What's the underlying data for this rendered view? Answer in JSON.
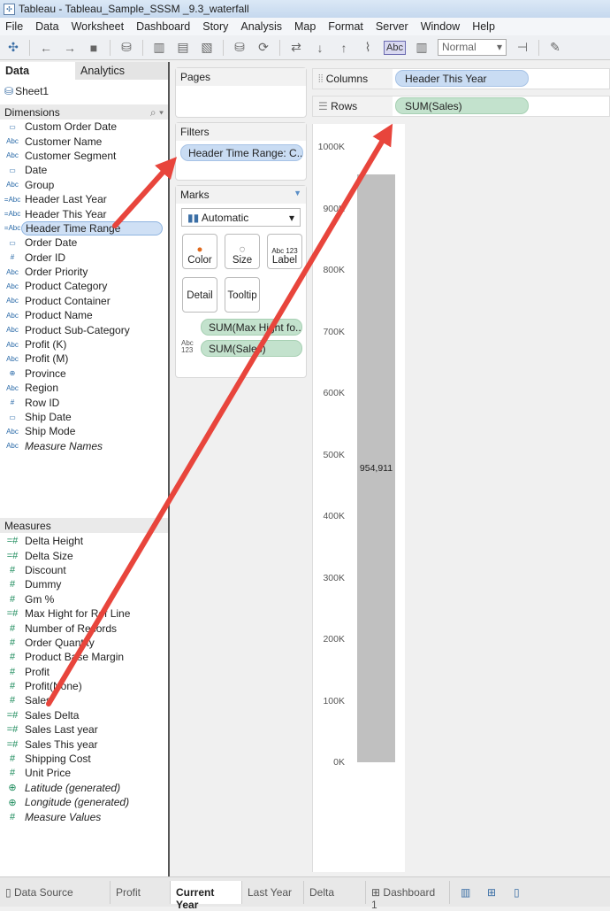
{
  "window": {
    "title": "Tableau - Tableau_Sample_SSSM _9.3_waterfall"
  },
  "menu": [
    "File",
    "Data",
    "Worksheet",
    "Dashboard",
    "Story",
    "Analysis",
    "Map",
    "Format",
    "Server",
    "Window",
    "Help"
  ],
  "toolbar": {
    "abc_label": "Abc",
    "fit_select": "Normal"
  },
  "left_panel": {
    "tabs": [
      "Data",
      "Analytics"
    ],
    "datasource": "Sheet1",
    "dimensions_label": "Dimensions",
    "dimensions": [
      {
        "name": "Custom Order Date",
        "icon": "calendar"
      },
      {
        "name": "Customer Name",
        "icon": "Abc"
      },
      {
        "name": "Customer Segment",
        "icon": "Abc"
      },
      {
        "name": "Date",
        "icon": "calendar"
      },
      {
        "name": "Group",
        "icon": "Abc"
      },
      {
        "name": "Header Last Year",
        "icon": "=Abc"
      },
      {
        "name": "Header This Year",
        "icon": "=Abc"
      },
      {
        "name": "Header Time Range",
        "icon": "=Abc",
        "selected": true
      },
      {
        "name": "Order Date",
        "icon": "calendar"
      },
      {
        "name": "Order ID",
        "icon": "#"
      },
      {
        "name": "Order Priority",
        "icon": "Abc"
      },
      {
        "name": "Product Category",
        "icon": "Abc"
      },
      {
        "name": "Product Container",
        "icon": "Abc"
      },
      {
        "name": "Product Name",
        "icon": "Abc"
      },
      {
        "name": "Product Sub-Category",
        "icon": "Abc"
      },
      {
        "name": "Profit (K)",
        "icon": "Abc"
      },
      {
        "name": "Profit (M)",
        "icon": "Abc"
      },
      {
        "name": "Province",
        "icon": "globe"
      },
      {
        "name": "Region",
        "icon": "Abc"
      },
      {
        "name": "Row ID",
        "icon": "#"
      },
      {
        "name": "Ship Date",
        "icon": "calendar"
      },
      {
        "name": "Ship Mode",
        "icon": "Abc"
      },
      {
        "name": "Measure Names",
        "icon": "Abc",
        "italic": true
      }
    ],
    "measures_label": "Measures",
    "measures": [
      {
        "name": "Delta Height",
        "icon": "=#"
      },
      {
        "name": "Delta Size",
        "icon": "=#"
      },
      {
        "name": "Discount",
        "icon": "#"
      },
      {
        "name": "Dummy",
        "icon": "#"
      },
      {
        "name": "Gm %",
        "icon": "#"
      },
      {
        "name": "Max Hight for Ref Line",
        "icon": "=#"
      },
      {
        "name": "Number of Records",
        "icon": "#"
      },
      {
        "name": "Order Quantity",
        "icon": "#"
      },
      {
        "name": "Product Base Margin",
        "icon": "#"
      },
      {
        "name": "Profit",
        "icon": "#"
      },
      {
        "name": "Profit(None)",
        "icon": "#"
      },
      {
        "name": "Sales",
        "icon": "#"
      },
      {
        "name": "Sales Delta",
        "icon": "=#"
      },
      {
        "name": "Sales Last year",
        "icon": "=#"
      },
      {
        "name": "Sales This year",
        "icon": "=#"
      },
      {
        "name": "Shipping Cost",
        "icon": "#"
      },
      {
        "name": "Unit Price",
        "icon": "#"
      },
      {
        "name": "Latitude (generated)",
        "icon": "globe",
        "italic": true
      },
      {
        "name": "Longitude (generated)",
        "icon": "globe",
        "italic": true
      },
      {
        "name": "Measure Values",
        "icon": "#",
        "italic": true
      }
    ]
  },
  "pages": {
    "label": "Pages"
  },
  "filters": {
    "label": "Filters",
    "pill": "Header Time Range: C.."
  },
  "marks": {
    "label": "Marks",
    "type": "Automatic",
    "buttons": [
      "Color",
      "Size",
      "Label",
      "Detail",
      "Tooltip"
    ],
    "pills": [
      "SUM(Max Hight fo..",
      "SUM(Sales)"
    ]
  },
  "shelves": {
    "columns_label": "Columns",
    "columns_pill": "Header This Year",
    "rows_label": "Rows",
    "rows_pill": "SUM(Sales)"
  },
  "chart_data": {
    "type": "bar",
    "categories": [
      ""
    ],
    "values": [
      954911
    ],
    "data_labels": [
      "954,911"
    ],
    "ylim": [
      0,
      1000000
    ],
    "yticks": [
      "0K",
      "100K",
      "200K",
      "300K",
      "400K",
      "500K",
      "600K",
      "700K",
      "800K",
      "900K",
      "1000K"
    ],
    "bar_color": "#c0c0c0"
  },
  "bottom_tabs": [
    "Data Source",
    "Profit",
    "Current Year",
    "Last Year",
    "Delta",
    "Dashboard 1"
  ],
  "active_tab": "Current Year",
  "annotation_color": "#e8453c"
}
